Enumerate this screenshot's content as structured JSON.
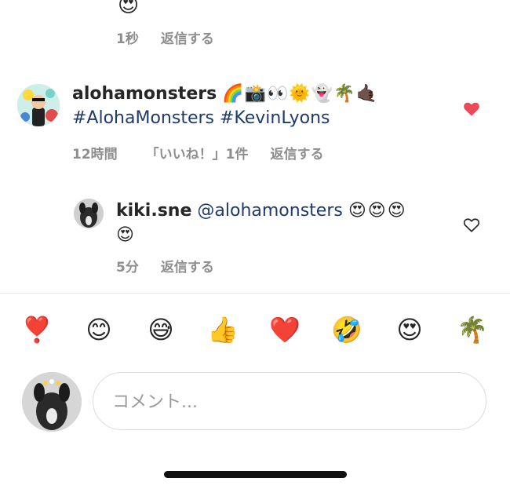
{
  "comments": [
    {
      "id": "prev",
      "trailing_emoji": "😍",
      "time": "1秒",
      "reply_label": "返信する"
    },
    {
      "id": "aloha",
      "username": "alohamonsters",
      "emojis": "🌈📸👀🌞👻🌴🤙🏿",
      "hashtags": "#AlohaMonsters #KevinLyons",
      "time": "12時間",
      "likes_label": "「いいね！」1件",
      "reply_label": "返信する",
      "liked": true
    },
    {
      "id": "kiki",
      "username": "kiki.sne",
      "mention": "@alohamonsters",
      "emojis_line1": "😍😍😍",
      "emojis_line2": "😍",
      "time": "5分",
      "reply_label": "返信する",
      "liked": false
    }
  ],
  "quick_reactions": [
    "❣️",
    "😊",
    "😅",
    "👍",
    "❤️",
    "🤣",
    "😍",
    "🌴"
  ],
  "composer": {
    "placeholder": "コメント..."
  },
  "colors": {
    "like_red": "#ed4956",
    "hashtag_blue": "#1f3a6b",
    "meta_gray": "#8e8e8e"
  }
}
